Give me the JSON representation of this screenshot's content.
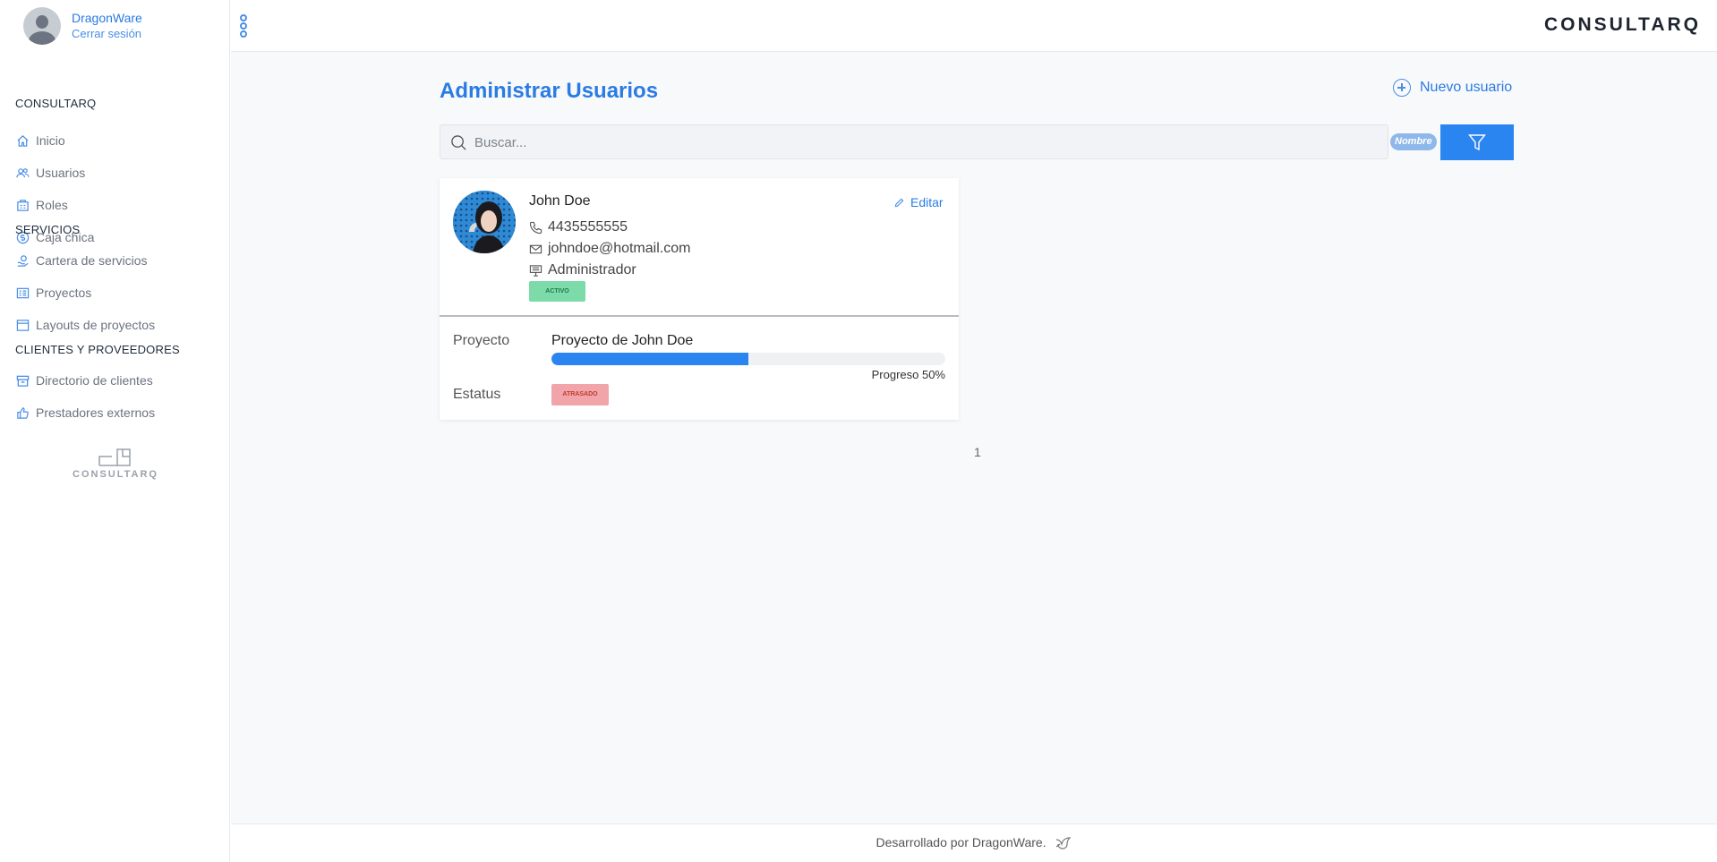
{
  "sidebar": {
    "user": {
      "name": "DragonWare",
      "logout": "Cerrar sesión"
    },
    "sections": [
      {
        "title": "CONSULTARQ",
        "items": [
          {
            "label": "Inicio",
            "icon": "home-icon"
          },
          {
            "label": "Usuarios",
            "icon": "users-icon"
          },
          {
            "label": "Roles",
            "icon": "roles-icon"
          },
          {
            "label": "Caja chica",
            "icon": "coin-icon"
          }
        ]
      },
      {
        "title": "SERVICIOS",
        "items": [
          {
            "label": "Cartera de servicios",
            "icon": "services-icon"
          },
          {
            "label": "Proyectos",
            "icon": "projects-icon"
          },
          {
            "label": "Layouts de proyectos",
            "icon": "layout-icon"
          }
        ]
      },
      {
        "title": "CLIENTES Y PROVEEDORES",
        "items": [
          {
            "label": "Directorio de clientes",
            "icon": "archive-icon"
          },
          {
            "label": "Prestadores externos",
            "icon": "thumbs-up-icon"
          }
        ]
      }
    ],
    "logo_text": "CONSULTARQ"
  },
  "header": {
    "brand": "CONSULTARQ"
  },
  "main": {
    "title": "Administrar Usuarios",
    "new_user_label": "Nuevo usuario",
    "search": {
      "placeholder": "Buscar...",
      "value": "",
      "filter_badge": "Nombre"
    },
    "users": [
      {
        "name": "John Doe",
        "edit_label": "Editar",
        "phone": "4435555555",
        "email": "johndoe@hotmail.com",
        "role": "Administrador",
        "status": "ACTIVO",
        "project_label": "Proyecto",
        "project_name": "Proyecto de John Doe",
        "progress": 50,
        "progress_text": "Progreso 50%",
        "status_label": "Estatus",
        "project_status": "ATRASADO"
      }
    ],
    "pagination": {
      "current": "1"
    }
  },
  "footer": {
    "text": "Desarrollado por DragonWare."
  },
  "colors": {
    "accent": "#2a7be4",
    "primary_button": "#2a85f0",
    "active": "#7ddbaa",
    "late": "#f1a5aa"
  }
}
